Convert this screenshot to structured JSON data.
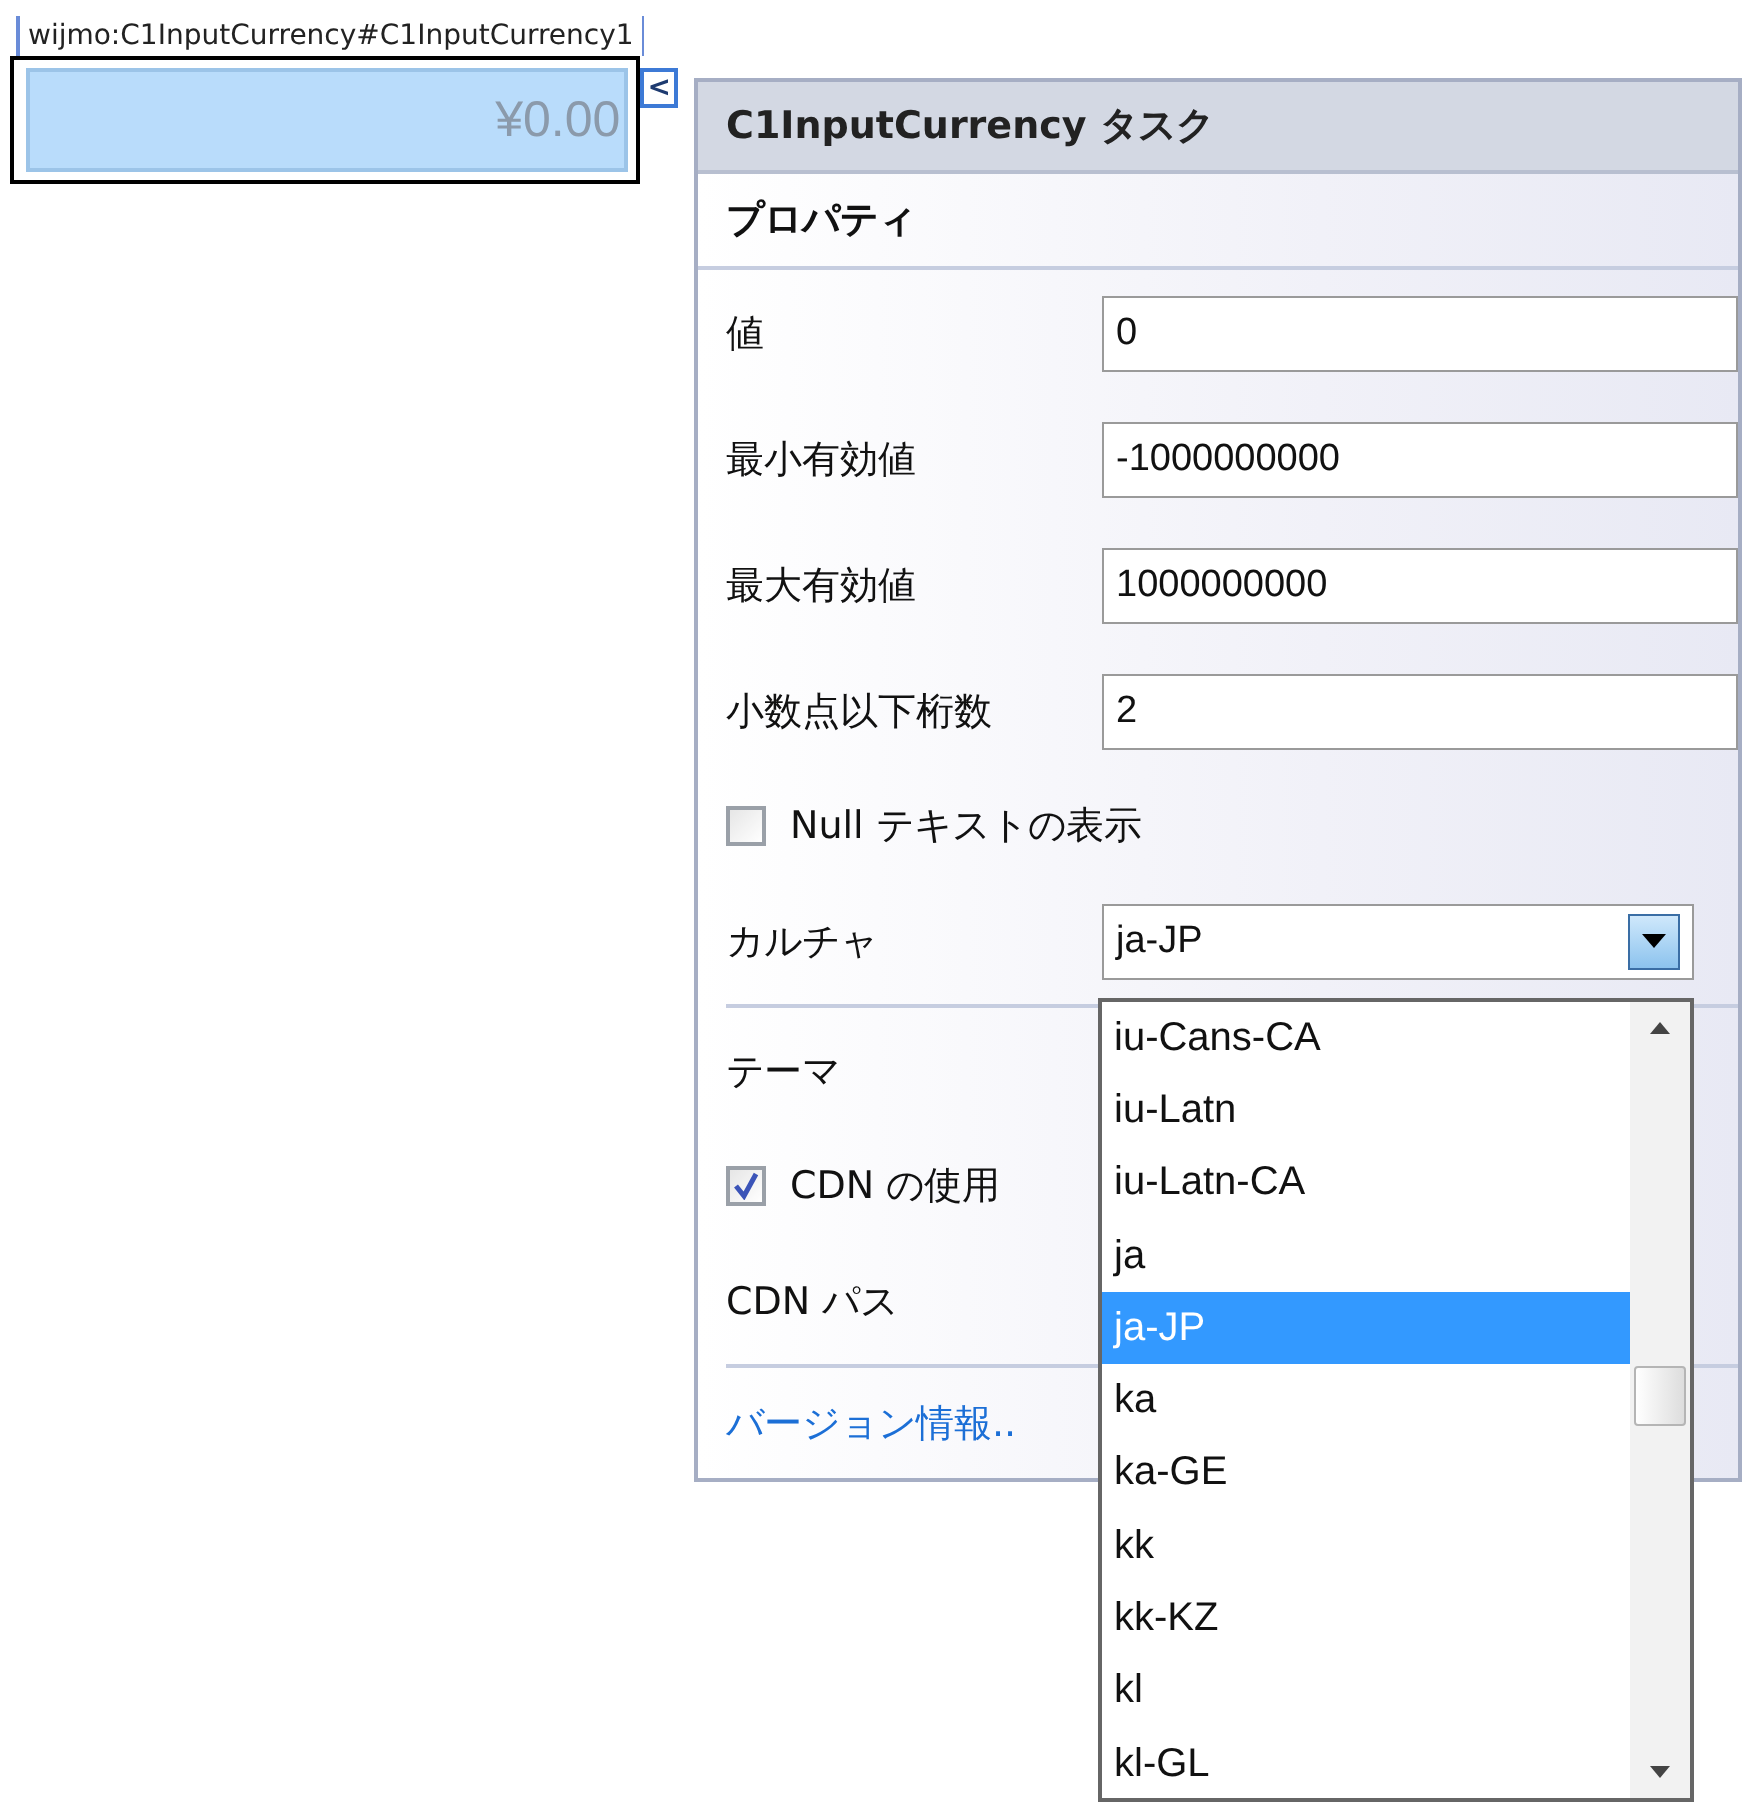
{
  "designer_tag": "wijmo:C1InputCurrency#C1InputCurrency1",
  "control": {
    "value": "¥0.00",
    "smart_tag_glyph": "<"
  },
  "task_panel": {
    "title": "C1InputCurrency タスク",
    "section": "プロパティ",
    "rows": [
      {
        "kind": "field",
        "label": "値",
        "value": "0"
      },
      {
        "kind": "field",
        "label": "最小有効値",
        "value": "-1000000000"
      },
      {
        "kind": "field",
        "label": "最大有効値",
        "value": "1000000000"
      },
      {
        "kind": "field",
        "label": "小数点以下桁数",
        "value": "2"
      },
      {
        "kind": "checkbox",
        "label": "Null テキストの表示",
        "checked": false
      },
      {
        "kind": "dropdown",
        "label": "カルチャ",
        "value": "ja-JP"
      },
      {
        "kind": "divider"
      },
      {
        "kind": "label",
        "label": "テーマ"
      },
      {
        "kind": "checkbox",
        "label": "CDN の使用",
        "checked": true
      },
      {
        "kind": "label",
        "label": "CDN パス"
      },
      {
        "kind": "divider"
      },
      {
        "kind": "link",
        "label": "バージョン情報.."
      }
    ],
    "dropdown_list": [
      {
        "label": "iu-Cans-CA",
        "selected": false
      },
      {
        "label": "iu-Latn",
        "selected": false
      },
      {
        "label": "iu-Latn-CA",
        "selected": false
      },
      {
        "label": "ja",
        "selected": false
      },
      {
        "label": "ja-JP",
        "selected": true
      },
      {
        "label": "ka",
        "selected": false
      },
      {
        "label": "ka-GE",
        "selected": false
      },
      {
        "label": "kk",
        "selected": false
      },
      {
        "label": "kk-KZ",
        "selected": false
      },
      {
        "label": "kl",
        "selected": false
      },
      {
        "label": "kl-GL",
        "selected": false
      }
    ]
  }
}
